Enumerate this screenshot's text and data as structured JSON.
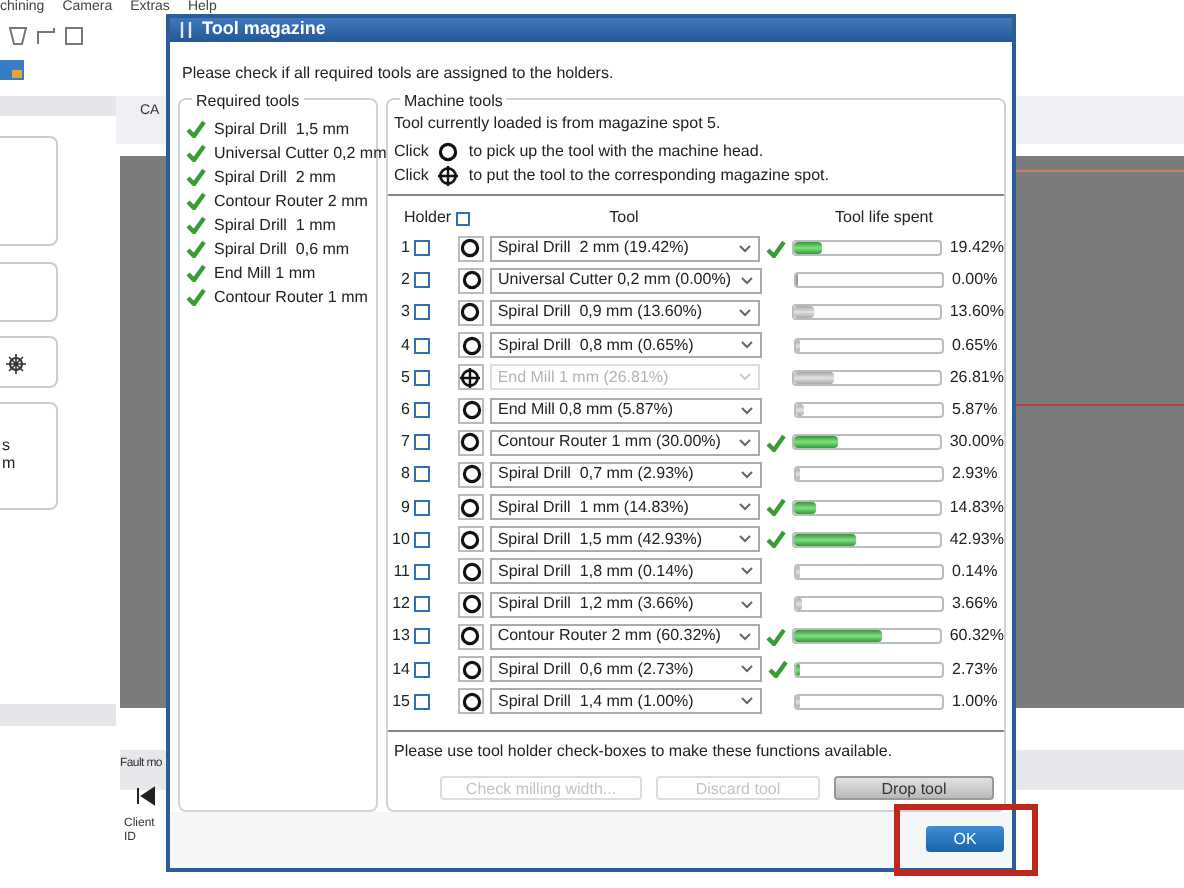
{
  "app": {
    "menu": [
      "chining",
      "Camera",
      "Extras",
      "Help"
    ],
    "doc_tab": "CA",
    "left_fragments": [
      "s",
      "m"
    ],
    "fault_tab": "Fault mo",
    "client_column": "Client ID"
  },
  "dialog": {
    "title": "Tool magazine",
    "instruction": "Please check if all required tools are assigned to the holders.",
    "required_tools": {
      "title": "Required tools",
      "items": [
        {
          "label": "Spiral Drill  1,5 mm",
          "ok": true
        },
        {
          "label": "Universal Cutter 0,2 mm",
          "ok": true
        },
        {
          "label": "Spiral Drill  2 mm",
          "ok": true
        },
        {
          "label": "Contour Router 2 mm",
          "ok": true
        },
        {
          "label": "Spiral Drill  1 mm",
          "ok": true
        },
        {
          "label": "Spiral Drill  0,6 mm",
          "ok": true
        },
        {
          "label": "End Mill 1 mm",
          "ok": true
        },
        {
          "label": "Contour Router 1 mm",
          "ok": true
        }
      ]
    },
    "machine_tools": {
      "title": "Machine tools",
      "info": "Tool currently loaded is from magazine spot 5.",
      "click_word_1": "Click",
      "pick_hint": "to pick up the tool with the machine head.",
      "click_word_2": "Click",
      "put_hint": "to put the tool to the corresponding magazine spot.",
      "columns": [
        "Holder",
        "Tool",
        "Tool life spent"
      ],
      "holder_all_checked": false,
      "rows": [
        {
          "number": "1",
          "checked": false,
          "kind": "pick",
          "tool": "Spiral Drill  2 mm (19.42%)",
          "disabled": false,
          "ok": true,
          "level": 0.1942,
          "reading": "19.42%"
        },
        {
          "number": "2",
          "checked": false,
          "kind": "pick",
          "tool": "Universal Cutter 0,2 mm (0.00%)",
          "disabled": false,
          "ok": false,
          "level": 0,
          "reading": "0.00%"
        },
        {
          "number": "3",
          "checked": false,
          "kind": "pick",
          "tool": "Spiral Drill  0,9 mm (13.60%)",
          "disabled": false,
          "ok": false,
          "level": 0.136,
          "reading": "13.60%"
        },
        {
          "number": "4",
          "checked": false,
          "kind": "pick",
          "tool": "Spiral Drill  0,8 mm (0.65%)",
          "disabled": false,
          "ok": false,
          "level": 0.0065,
          "reading": "0.65%"
        },
        {
          "number": "5",
          "checked": false,
          "kind": "put",
          "tool": "End Mill 1 mm (26.81%)",
          "disabled": true,
          "ok": false,
          "level": 0.2681,
          "reading": "26.81%"
        },
        {
          "number": "6",
          "checked": false,
          "kind": "pick",
          "tool": "End Mill 0,8 mm (5.87%)",
          "disabled": false,
          "ok": false,
          "level": 0.0587,
          "reading": "5.87%"
        },
        {
          "number": "7",
          "checked": false,
          "kind": "pick",
          "tool": "Contour Router 1 mm (30.00%)",
          "disabled": false,
          "ok": true,
          "level": 0.3,
          "reading": "30.00%"
        },
        {
          "number": "8",
          "checked": false,
          "kind": "pick",
          "tool": "Spiral Drill  0,7 mm (2.93%)",
          "disabled": false,
          "ok": false,
          "level": 0.0293,
          "reading": "2.93%"
        },
        {
          "number": "9",
          "checked": false,
          "kind": "pick",
          "tool": "Spiral Drill  1 mm (14.83%)",
          "disabled": false,
          "ok": true,
          "level": 0.1483,
          "reading": "14.83%"
        },
        {
          "number": "10",
          "checked": false,
          "kind": "pick",
          "tool": "Spiral Drill  1,5 mm (42.93%)",
          "disabled": false,
          "ok": true,
          "level": 0.4293,
          "reading": "42.93%"
        },
        {
          "number": "11",
          "checked": false,
          "kind": "pick",
          "tool": "Spiral Drill  1,8 mm (0.14%)",
          "disabled": false,
          "ok": false,
          "level": 0.0014,
          "reading": "0.14%"
        },
        {
          "number": "12",
          "checked": false,
          "kind": "pick",
          "tool": "Spiral Drill  1,2 mm (3.66%)",
          "disabled": false,
          "ok": false,
          "level": 0.0366,
          "reading": "3.66%"
        },
        {
          "number": "13",
          "checked": false,
          "kind": "pick",
          "tool": "Contour Router 2 mm (60.32%)",
          "disabled": false,
          "ok": true,
          "level": 0.6032,
          "reading": "60.32%"
        },
        {
          "number": "14",
          "checked": false,
          "kind": "pick",
          "tool": "Spiral Drill  0,6 mm (2.73%)",
          "disabled": false,
          "ok": true,
          "level": 0.0273,
          "reading": "2.73%"
        },
        {
          "number": "15",
          "checked": false,
          "kind": "pick",
          "tool": "Spiral Drill  1,4 mm (1.00%)",
          "disabled": false,
          "ok": false,
          "level": 0.01,
          "reading": "1.00%"
        }
      ],
      "footer_note": "Please use tool holder check-boxes to make these functions available.",
      "actions": [
        {
          "label": "Check milling width...",
          "disabled": true
        },
        {
          "label": "Discard tool",
          "disabled": true
        },
        {
          "label": "Drop tool",
          "disabled": false
        }
      ]
    },
    "ok_button": "OK"
  }
}
